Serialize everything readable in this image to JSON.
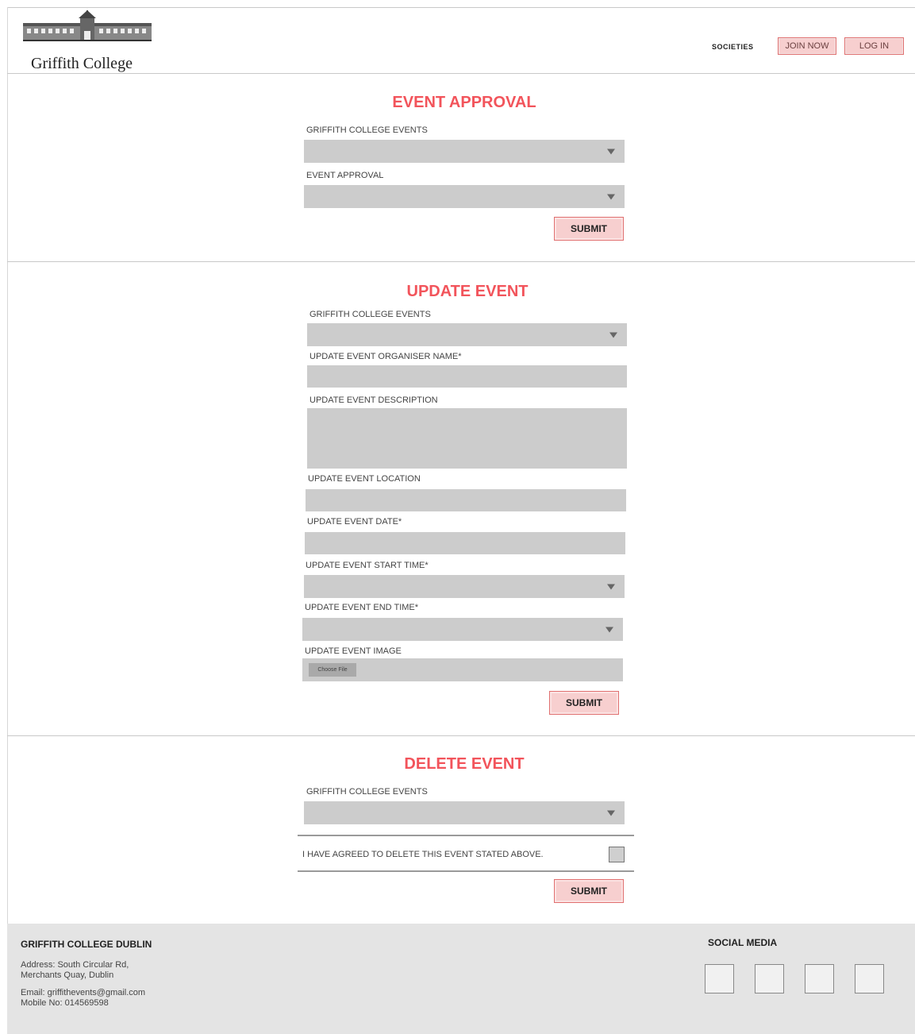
{
  "header": {
    "logo_text": "Griffith College",
    "nav": {
      "societies": "SOCIETIES",
      "join_now": "JOIN NOW",
      "log_in": "LOG IN"
    }
  },
  "approval": {
    "title": "EVENT APPROVAL",
    "events_label": "GRIFFITH COLLEGE EVENTS",
    "approval_label": "EVENT APPROVAL",
    "submit": "SUBMIT"
  },
  "update": {
    "title": "UPDATE EVENT",
    "events_label": "GRIFFITH COLLEGE EVENTS",
    "organiser_label": "UPDATE EVENT ORGANISER NAME*",
    "description_label": "UPDATE EVENT DESCRIPTION",
    "location_label": "UPDATE EVENT LOCATION",
    "date_label": "UPDATE EVENT DATE*",
    "start_label": "UPDATE EVENT START TIME*",
    "end_label": "UPDATE EVENT END TIME*",
    "image_label": "UPDATE EVENT IMAGE",
    "choose_file": "Choose File",
    "submit": "SUBMIT"
  },
  "delete": {
    "title": "DELETE EVENT",
    "events_label": "GRIFFITH COLLEGE EVENTS",
    "agree_label": "I HAVE AGREED TO DELETE THIS EVENT STATED ABOVE.",
    "submit": "SUBMIT"
  },
  "footer": {
    "org": "GRIFFITH COLLEGE DUBLIN",
    "address": "Address: South Circular Rd,\nMerchants Quay, Dublin",
    "contact": "Email: griffithevents@gmail.com\nMobile No: 014569598",
    "social_title": "SOCIAL MEDIA"
  }
}
